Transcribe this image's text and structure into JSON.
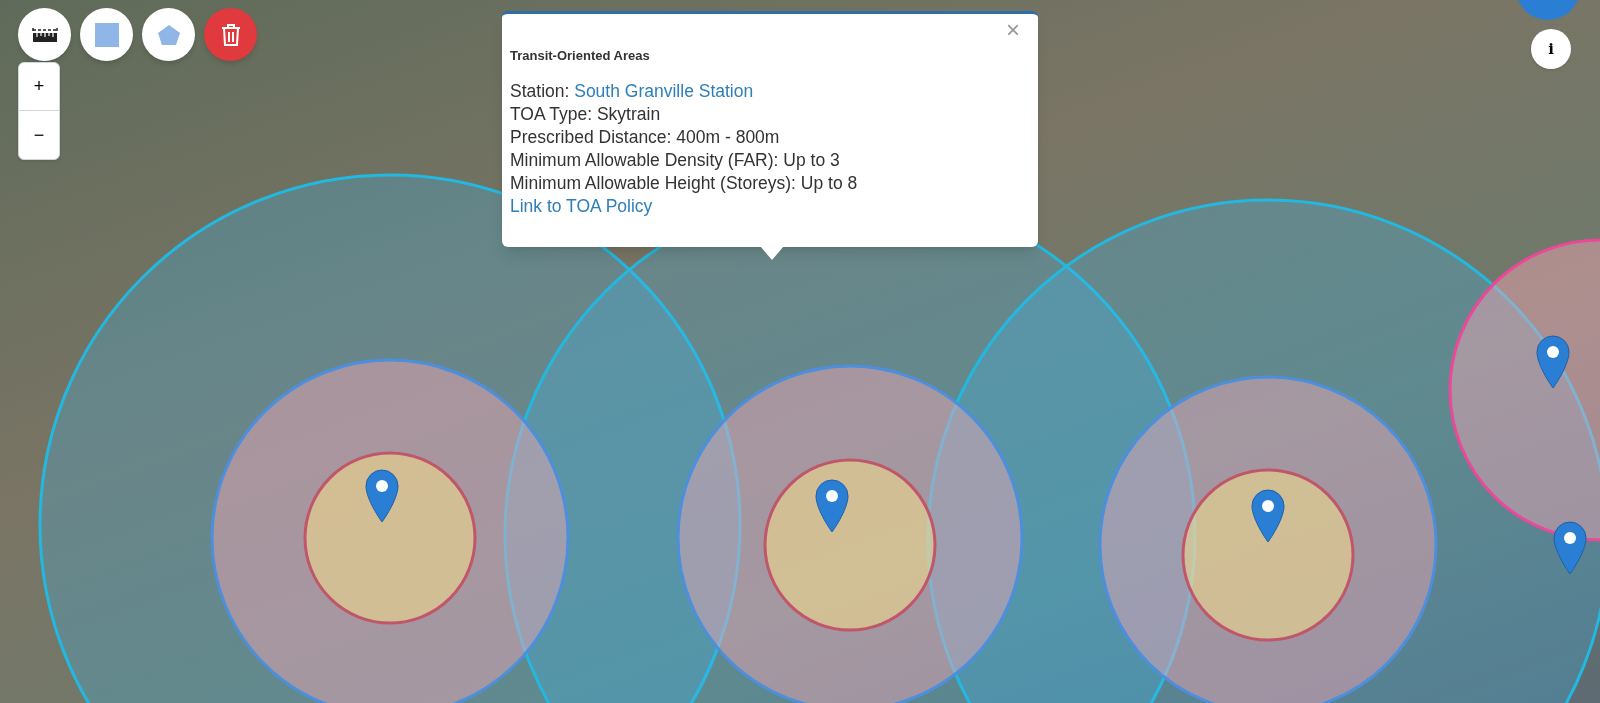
{
  "draw_tools": [
    {
      "kind": "ruler"
    },
    {
      "kind": "rectangle"
    },
    {
      "kind": "polygon"
    },
    {
      "kind": "delete"
    }
  ],
  "zoom_controls": [
    "+",
    "−"
  ],
  "info_button": "i",
  "popup": {
    "close": "×",
    "title": "Transit-Oriented Areas",
    "lines": [
      {
        "label": "Station: ",
        "value": "South Granville Station",
        "kind": "link"
      },
      {
        "label": "TOA Type: ",
        "value": "Skytrain",
        "kind": "text"
      },
      {
        "label": "Prescribed Distance: ",
        "value": "400m - 800m",
        "kind": "text"
      },
      {
        "label": "Minimum Allowable Density (FAR): ",
        "value": "Up to 3",
        "kind": "text"
      },
      {
        "label": "Minimum Allowable Height (Storeys): ",
        "value": "Up to 8",
        "kind": "text"
      }
    ],
    "policy_link": "Link to TOA Policy"
  }
}
